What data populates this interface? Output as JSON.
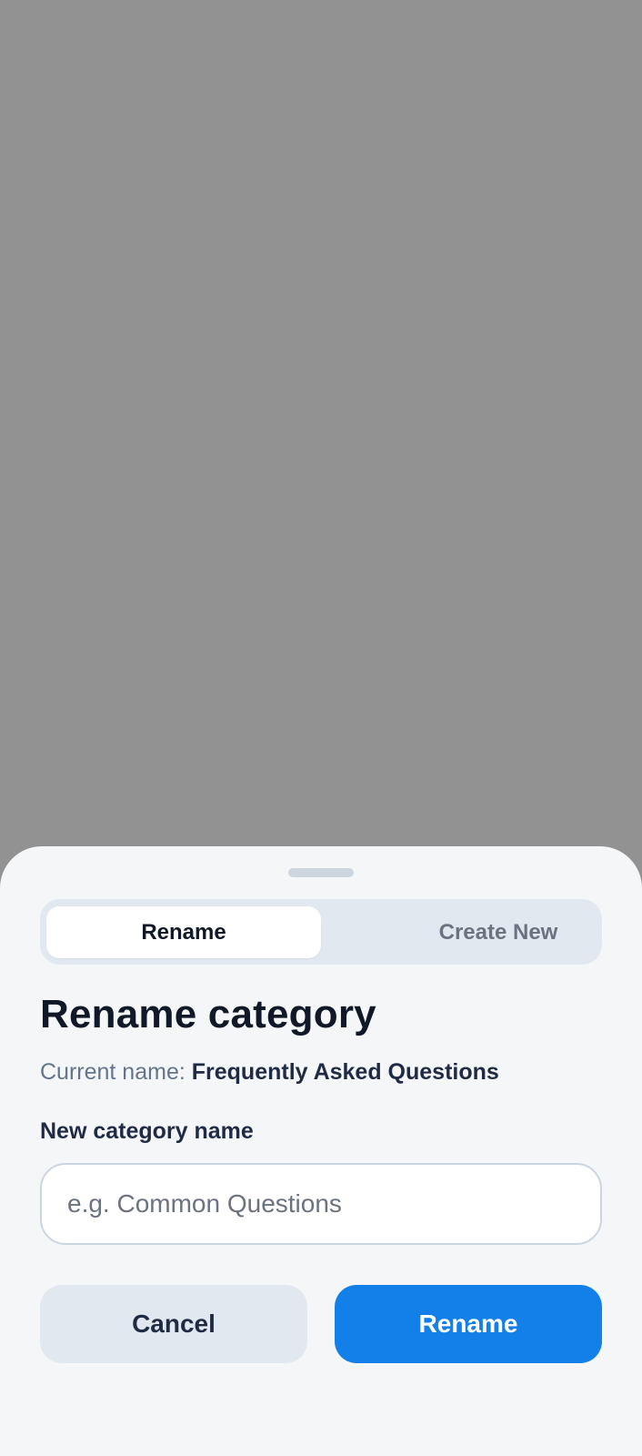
{
  "tabs": {
    "rename_label": "Rename",
    "create_new_label": "Create New",
    "active": "Rename"
  },
  "dialog": {
    "title": "Rename category",
    "current_name_label": "Current name:",
    "current_name_value": "Frequently Asked Questions",
    "field_label": "New category name",
    "input_value": "",
    "input_placeholder": "e.g. Common Questions"
  },
  "actions": {
    "cancel_label": "Cancel",
    "confirm_label": "Rename"
  },
  "colors": {
    "backdrop": "#929292",
    "sheet_bg": "#f4f6f8",
    "primary": "#1380ea",
    "segment_bg": "#e2e8f0"
  }
}
